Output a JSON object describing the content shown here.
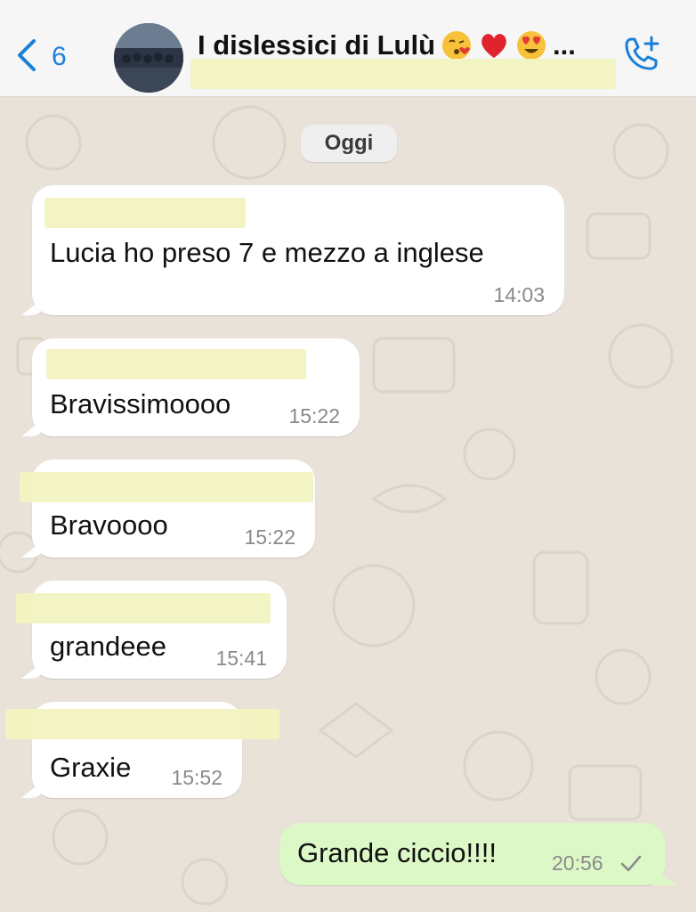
{
  "header": {
    "back_count": "6",
    "group_name": "I dislessici di Lulù",
    "title_emojis": [
      "kissing-face-emoji",
      "red-heart-emoji",
      "heart-eyes-emoji"
    ],
    "ellipsis": "..."
  },
  "date_separator": "Oggi",
  "messages": [
    {
      "text": "Lucia ho preso 7 e mezzo a inglese",
      "time": "14:03",
      "direction": "incoming"
    },
    {
      "text": "Bravissimoooo",
      "time": "15:22",
      "direction": "incoming"
    },
    {
      "text": "Bravoooo",
      "time": "15:22",
      "direction": "incoming"
    },
    {
      "text": "grandeee",
      "time": "15:41",
      "direction": "incoming"
    },
    {
      "text": "Graxie",
      "time": "15:52",
      "direction": "incoming"
    },
    {
      "text": "Grande ciccio!!!!",
      "time": "20:56",
      "direction": "outgoing",
      "status": "sent-check-icon"
    }
  ],
  "colors": {
    "accent": "#1a7fd6",
    "wallpaper": "#e9e2d9",
    "outgoing_bubble": "#dcf8c6",
    "incoming_bubble": "#ffffff",
    "highlight": "#f1f3c0"
  }
}
